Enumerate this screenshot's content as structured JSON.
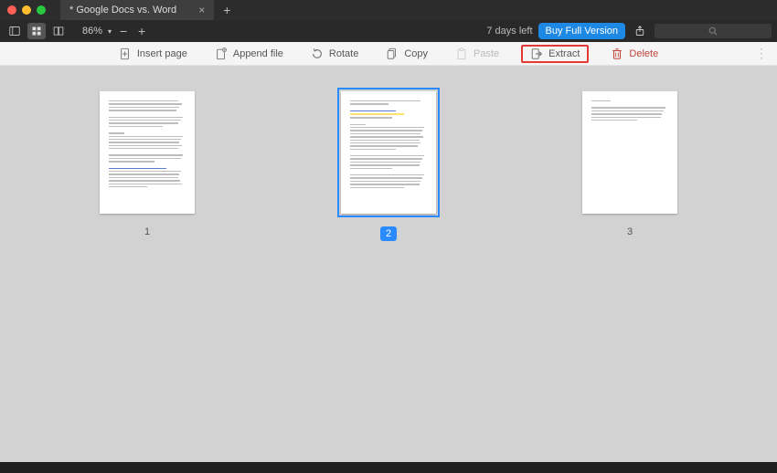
{
  "tab": {
    "title": "* Google Docs vs. Word"
  },
  "zoom": {
    "label": "86%"
  },
  "trial": {
    "days_left": "7 days left",
    "buy_label": "Buy Full Version"
  },
  "toolbar": {
    "insert_page": "Insert page",
    "append_file": "Append file",
    "rotate": "Rotate",
    "copy": "Copy",
    "paste": "Paste",
    "extract": "Extract",
    "delete": "Delete"
  },
  "pages": {
    "p1": "1",
    "p2": "2",
    "p3": "3"
  }
}
